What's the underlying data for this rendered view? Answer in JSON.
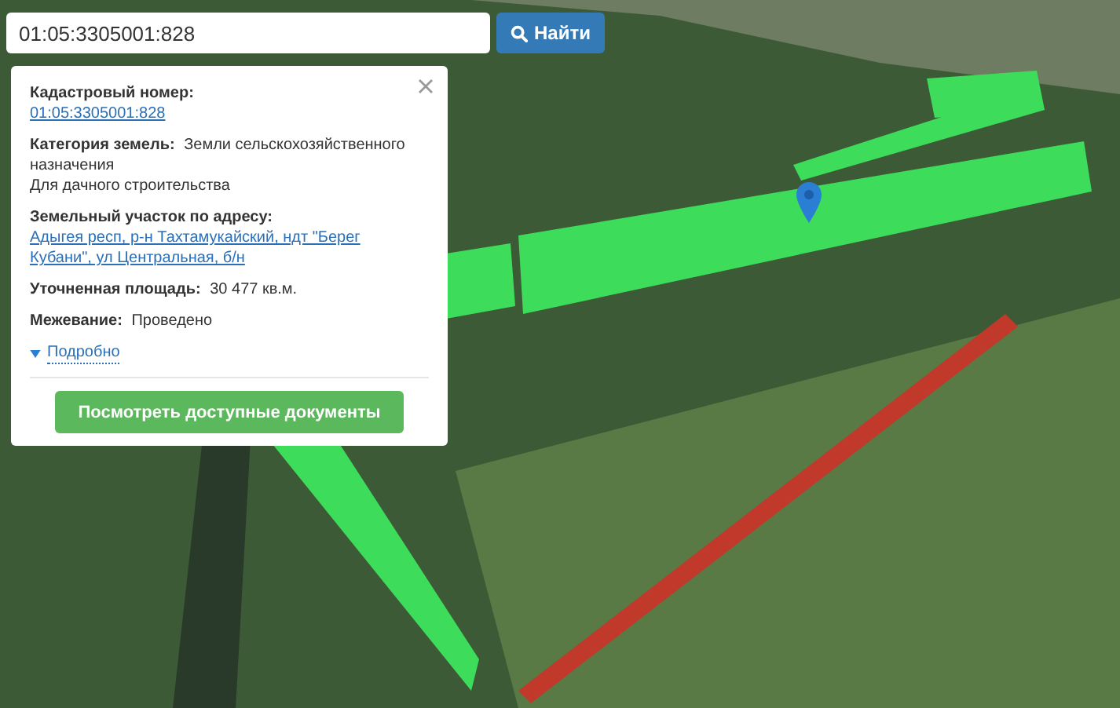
{
  "search": {
    "value": "01:05:3305001:828",
    "button": "Найти"
  },
  "popup": {
    "fields": [
      {
        "kind": "link",
        "label": "Кадастровый номер:",
        "value": "01:05:3305001:828"
      },
      {
        "kind": "text",
        "label": "Категория земель:",
        "value": "Земли сельскохозяйственного назначения"
      },
      {
        "kind": "note",
        "value": "Для дачного строительства"
      },
      {
        "kind": "link",
        "label": "Земельный участок по адресу:",
        "value": "Адыгея респ, р-н Тахтамукайский, ндт \"Берег Кубани\", ул Центральная, б/н"
      },
      {
        "kind": "text",
        "label": "Уточненная площадь:",
        "value": "30 477 кв.м."
      },
      {
        "kind": "text",
        "label": "Межевание:",
        "value": "Проведено"
      }
    ],
    "details": {
      "label": "Подробно",
      "expanded": false
    },
    "button": "Посмотреть доступные документы"
  }
}
